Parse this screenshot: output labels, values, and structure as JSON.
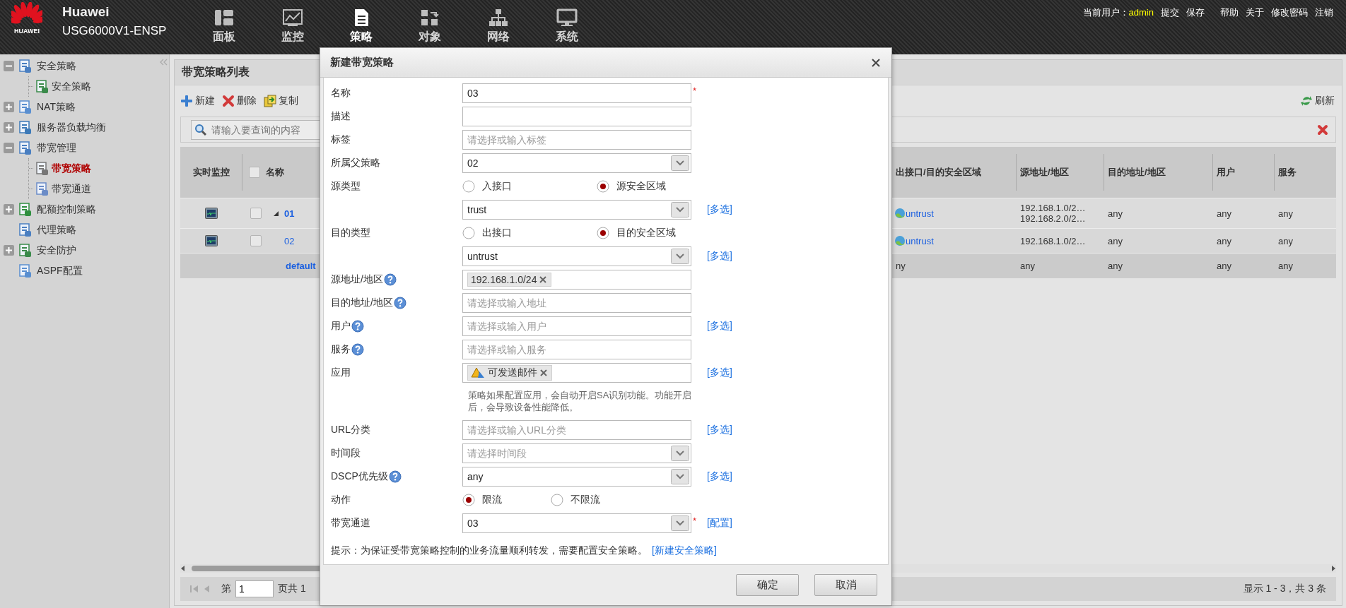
{
  "top_bar": {
    "logo_text": "HUAWEI",
    "brand": "Huawei",
    "model": "USG6000V1-ENSP",
    "nav": [
      {
        "label": "面板",
        "selected": false
      },
      {
        "label": "监控",
        "selected": false
      },
      {
        "label": "策略",
        "selected": true
      },
      {
        "label": "对象",
        "selected": false
      },
      {
        "label": "网络",
        "selected": false
      },
      {
        "label": "系统",
        "selected": false
      }
    ],
    "user_label": "当前用户：",
    "user": "admin",
    "links": [
      "提交",
      "保存",
      "帮助",
      "关于",
      "修改密码",
      "注销"
    ]
  },
  "sidebar": {
    "items": [
      {
        "label": "安全策略",
        "expanded": true,
        "selected": false,
        "children": [
          {
            "label": "安全策略",
            "selected": false
          }
        ]
      },
      {
        "label": "NAT策略",
        "expanded": false,
        "selected": false
      },
      {
        "label": "服务器负载均衡",
        "expanded": false,
        "selected": false
      },
      {
        "label": "带宽管理",
        "expanded": true,
        "selected": false,
        "children": [
          {
            "label": "带宽策略",
            "selected": true
          },
          {
            "label": "带宽通道",
            "selected": false
          }
        ]
      },
      {
        "label": "配额控制策略",
        "expanded": false,
        "selected": false
      },
      {
        "label": "代理策略",
        "selected": false
      },
      {
        "label": "安全防护",
        "expanded": false,
        "selected": false
      },
      {
        "label": "ASPF配置",
        "selected": false
      }
    ]
  },
  "policy_list": {
    "title": "带宽策略列表",
    "toolbar": [
      "新建",
      "删除",
      "复制"
    ],
    "refresh": "刷新",
    "search": {
      "placeholder": "请输入要查询的内容"
    },
    "table": {
      "all_checked": false,
      "columns": [
        "实时监控",
        "名称",
        "出接口/目的安全区域",
        "源地址/地区",
        "目的地址/地区",
        "用户",
        "服务"
      ],
      "rows": [
        {
          "kind": "policy",
          "checked": false,
          "expanded": true,
          "name": "01",
          "zone": "untrust",
          "source": [
            "192.168.1.0/2…",
            "192.168.2.0/2…"
          ],
          "destination": "any",
          "user": "any",
          "service": "any",
          "children": [
            {
              "kind": "policy",
              "checked": false,
              "name": "02",
              "zone": "untrust",
              "source": [
                "192.168.1.0/2…"
              ],
              "destination": "any",
              "user": "any",
              "service": "any"
            }
          ]
        },
        {
          "kind": "default",
          "name": "default",
          "zone": "ny",
          "source": [
            "any"
          ],
          "destination": "any",
          "user": "any",
          "service": "any"
        }
      ]
    },
    "pager": {
      "prefix": "第",
      "page": "1",
      "suffix": "页共 1",
      "summary": "显示 1 - 3，共 3 条"
    }
  },
  "dialog": {
    "title": "新建带宽策略",
    "fields": [
      {
        "kind": "text",
        "label": "名称",
        "value": "03",
        "required_mark": "*"
      },
      {
        "kind": "text",
        "label": "描述"
      },
      {
        "kind": "text",
        "label": "标签",
        "placeholder": "请选择或输入标签"
      },
      {
        "kind": "select",
        "label": "所属父策略",
        "value": "02"
      },
      {
        "kind": "radio",
        "label": "源类型",
        "options": [
          {
            "label": "入接口",
            "selected": false
          },
          {
            "label": "源安全区域",
            "selected": true
          }
        ]
      },
      {
        "kind": "select",
        "value": "trust",
        "link": "[多选]"
      },
      {
        "kind": "radio",
        "label": "目的类型",
        "options": [
          {
            "label": "出接口",
            "selected": false
          },
          {
            "label": "目的安全区域",
            "selected": true
          }
        ]
      },
      {
        "kind": "select",
        "value": "untrust",
        "link": "[多选]"
      },
      {
        "kind": "tags",
        "label": "源地址/地区",
        "help": true,
        "tags": [
          {
            "text": "192.168.1.0/24",
            "kind": "address"
          }
        ]
      },
      {
        "kind": "text",
        "label": "目的地址/地区",
        "help": true,
        "placeholder": "请选择或输入地址"
      },
      {
        "kind": "text",
        "label": "用户",
        "help": true,
        "placeholder": "请选择或输入用户",
        "link": "[多选]"
      },
      {
        "kind": "text",
        "label": "服务",
        "help": true,
        "placeholder": "请选择或输入服务"
      },
      {
        "kind": "tags",
        "label": "应用",
        "tags": [
          {
            "text": "可发送邮件",
            "kind": "application"
          }
        ],
        "link": "[多选]"
      },
      {
        "kind": "note",
        "text": "策略如果配置应用，会自动开启SA识别功能。功能开启后，会导致设备性能降低。"
      },
      {
        "kind": "text",
        "label": "URL分类",
        "placeholder": "请选择或输入URL分类",
        "link": "[多选]"
      },
      {
        "kind": "select",
        "label": "时间段",
        "placeholder": "请选择时间段"
      },
      {
        "kind": "select",
        "label": "DSCP优先级",
        "help": true,
        "value": "any",
        "link": "[多选]"
      },
      {
        "kind": "radio",
        "label": "动作",
        "options": [
          {
            "label": "限流",
            "selected": true
          },
          {
            "label": "不限流",
            "selected": false
          }
        ]
      },
      {
        "kind": "select",
        "label": "带宽通道",
        "value": "03",
        "required_mark": "*",
        "link": "[配置]"
      }
    ],
    "tip": {
      "text": "提示：为保证受带宽策略控制的业务流量顺利转发，需要配置安全策略。",
      "link": "[新建安全策略]"
    },
    "buttons": [
      "确定",
      "取消"
    ]
  }
}
